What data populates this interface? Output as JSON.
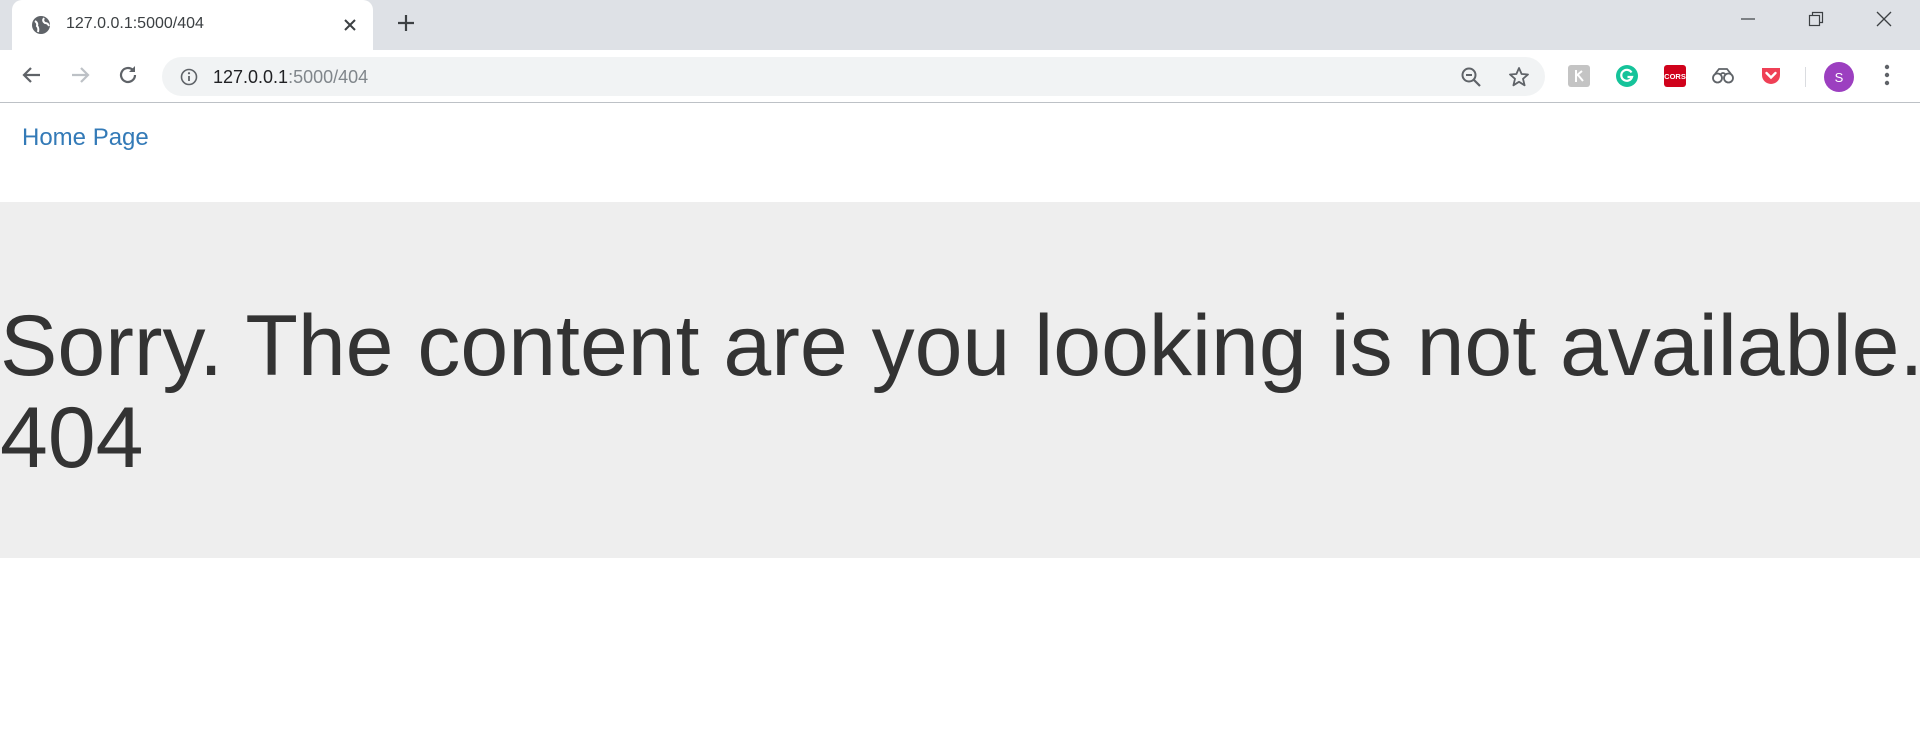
{
  "browser": {
    "tab": {
      "title": "127.0.0.1:5000/404",
      "favicon": "globe-icon"
    },
    "address_bar": {
      "host": "127.0.0.1",
      "path": ":5000/404"
    },
    "profile_initial": "S",
    "extensions": [
      "ext-grey-icon",
      "grammarly-icon",
      "cors-icon",
      "binoculars-icon",
      "pocket-icon"
    ],
    "colors": {
      "tabstrip": "#dee1e6",
      "omnibox": "#f1f3f4",
      "avatar": "#9c3fc0"
    }
  },
  "page": {
    "nav": {
      "home_link": "Home Page"
    },
    "error": {
      "message": "Sorry. The content are you looking is not available.",
      "code": "404"
    },
    "colors": {
      "link": "#337ab7",
      "jumbotron_bg": "#eeeeee",
      "text": "#333333"
    }
  }
}
